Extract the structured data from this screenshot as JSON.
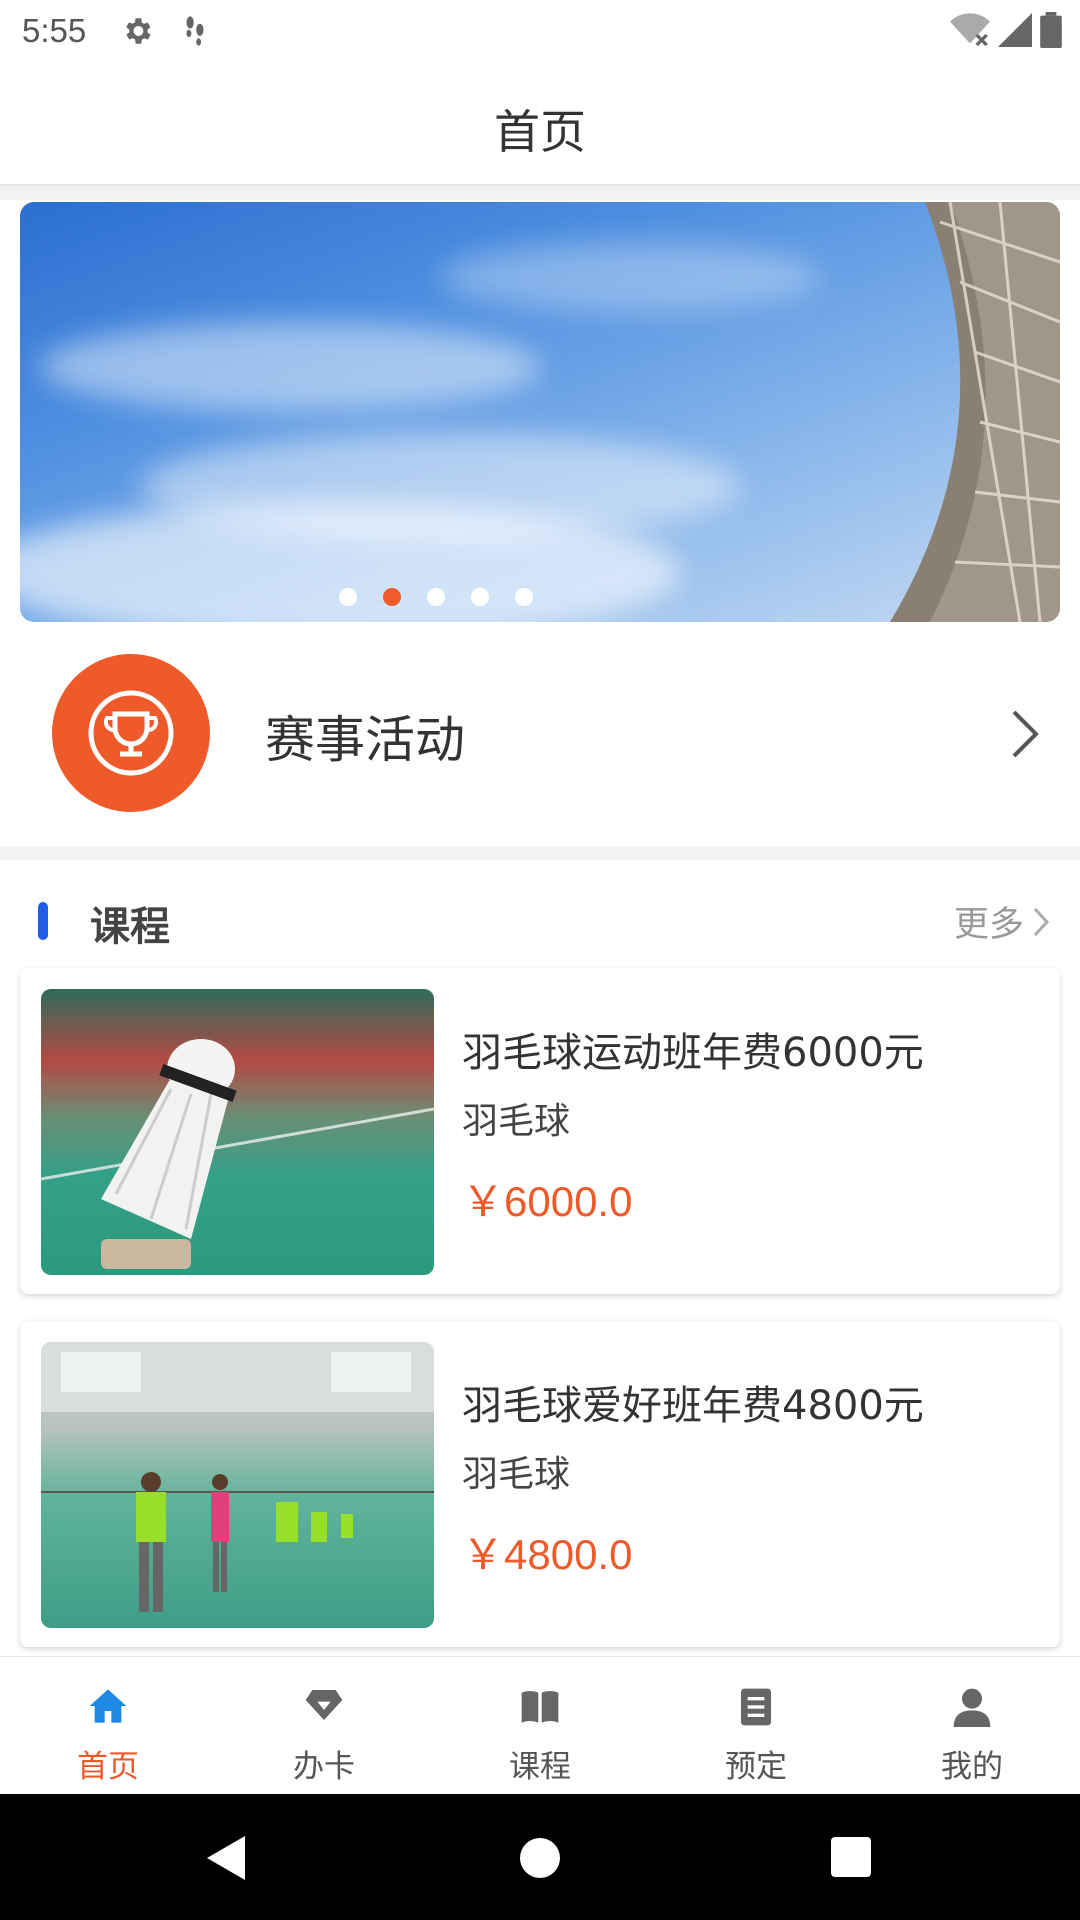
{
  "status_bar": {
    "time": "5:55"
  },
  "app_bar": {
    "title": "首页"
  },
  "banner": {
    "dot_count": 5,
    "active_index": 1
  },
  "event": {
    "label": "赛事活动"
  },
  "courses_section": {
    "title": "课程",
    "more_label": "更多"
  },
  "courses": [
    {
      "title": "羽毛球运动班年费6000元",
      "category": "羽毛球",
      "price": "￥6000.0"
    },
    {
      "title": "羽毛球爱好班年费4800元",
      "category": "羽毛球",
      "price": "￥4800.0"
    }
  ],
  "bottom_nav": [
    {
      "label": "首页",
      "icon": "home-icon",
      "active": true
    },
    {
      "label": "办卡",
      "icon": "diamond-icon",
      "active": false
    },
    {
      "label": "课程",
      "icon": "book-icon",
      "active": false
    },
    {
      "label": "预定",
      "icon": "document-icon",
      "active": false
    },
    {
      "label": "我的",
      "icon": "user-icon",
      "active": false
    }
  ],
  "colors": {
    "accent": "#ef5a2a",
    "section_bar": "#1e5ee6",
    "nav_active_icon": "#1e88e5"
  }
}
